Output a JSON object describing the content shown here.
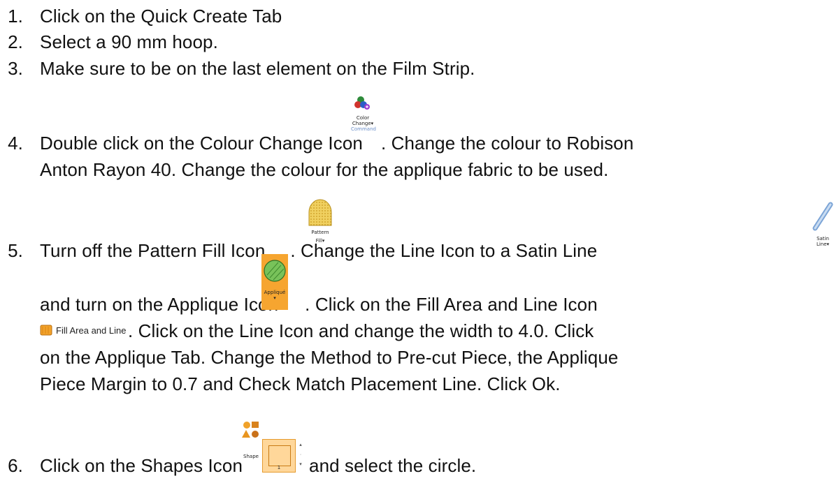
{
  "steps": [
    {
      "number": "1.",
      "text": "Click on the Quick Create Tab"
    },
    {
      "number": "2.",
      "text": "Select a 90 mm hoop."
    },
    {
      "number": "3.",
      "text": "Make sure to be on the last element on the Film Strip."
    },
    {
      "number": "4.",
      "part_a": "Double click on the Colour Change Icon",
      "part_b": ".  Change the colour to Robison",
      "line2": "Anton Rayon 40.  Change the colour for the applique fabric to be used."
    },
    {
      "number": "5.",
      "part_a": "Turn off the Pattern Fill Icon",
      "part_b": ".  Change the Line Icon to a Satin Line",
      "line2_a": "and turn on the Applique Icon",
      "line2_b": ".  Click on the Fill Area and Line Icon",
      "line3": ".  Click on the Line Icon and change the width to 4.0.  Click",
      "line4": "on the Applique Tab.  Change the Method to Pre-cut Piece, the Applique",
      "line5": "Piece Margin to 0.7 and Check Match Placement Line.  Click Ok."
    },
    {
      "number": "6.",
      "part_a": "Click on the Shapes Icon",
      "part_b": "and select the circle."
    }
  ],
  "icons": {
    "color_change": {
      "name": "color-change-icon",
      "label1": "Color",
      "label2": "Change▾",
      "label3": "Command"
    },
    "pattern_fill": {
      "name": "pattern-fill-icon",
      "label1": "Pattern",
      "label2": "Fill▾"
    },
    "satin_line": {
      "name": "satin-line-icon",
      "label1": "Satin",
      "label2": "Line▾"
    },
    "applique": {
      "name": "applique-icon",
      "label1": "Appliqué",
      "label2": "▾"
    },
    "fill_area_line": {
      "name": "fill-area-and-line-icon",
      "label": "Fill Area and Line"
    },
    "shapes": {
      "name": "shapes-icon",
      "label": "Shape",
      "spin_value": "1"
    }
  }
}
